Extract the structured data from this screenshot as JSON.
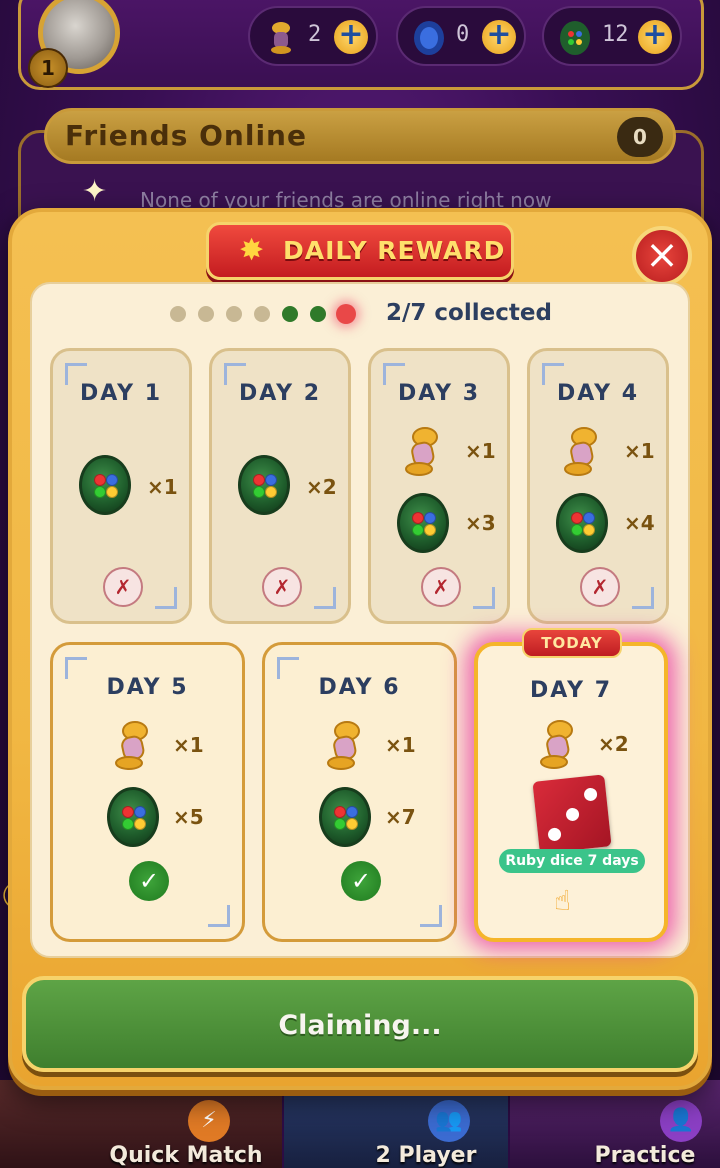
{
  "header": {
    "level": "1",
    "currencies": [
      {
        "icon": "lamp-icon",
        "value": "2"
      },
      {
        "icon": "sapphire-coin-icon",
        "value": "0"
      },
      {
        "icon": "emerald-coin-icon",
        "value": "12"
      }
    ],
    "add_label": "+"
  },
  "friends": {
    "title": "Friends Online",
    "count": "0",
    "empty_message": "None of your friends are online right now"
  },
  "modal": {
    "title": "DAILY REWARD",
    "close_label": "×",
    "progress": {
      "collected": 2,
      "total": 7,
      "text": "2/7 collected"
    },
    "days": [
      {
        "label": "DAY 1",
        "status": "missed",
        "rewards": [
          {
            "item": "coin",
            "qty": "×1"
          }
        ]
      },
      {
        "label": "DAY 2",
        "status": "missed",
        "rewards": [
          {
            "item": "coin",
            "qty": "×2"
          }
        ]
      },
      {
        "label": "DAY 3",
        "status": "missed",
        "rewards": [
          {
            "item": "lamp",
            "qty": "×1"
          },
          {
            "item": "coin",
            "qty": "×3"
          }
        ]
      },
      {
        "label": "DAY 4",
        "status": "missed",
        "rewards": [
          {
            "item": "lamp",
            "qty": "×1"
          },
          {
            "item": "coin",
            "qty": "×4"
          }
        ]
      },
      {
        "label": "DAY 5",
        "status": "collected",
        "rewards": [
          {
            "item": "lamp",
            "qty": "×1"
          },
          {
            "item": "coin",
            "qty": "×5"
          }
        ]
      },
      {
        "label": "DAY 6",
        "status": "collected",
        "rewards": [
          {
            "item": "lamp",
            "qty": "×1"
          },
          {
            "item": "coin",
            "qty": "×7"
          }
        ]
      },
      {
        "label": "DAY 7",
        "status": "today",
        "badge": "TODAY",
        "rewards": [
          {
            "item": "lamp",
            "qty": "×2"
          },
          {
            "item": "ruby-dice",
            "label": "Ruby dice 7 days"
          }
        ]
      }
    ],
    "missed_mark": "✗",
    "collected_mark": "✓",
    "claim_button": "Claiming..."
  },
  "bottom_modes": [
    {
      "label": "Quick Match",
      "icon": "lightning-icon"
    },
    {
      "label": "2 Player",
      "icon": "people-icon"
    },
    {
      "label": "Practice",
      "icon": "person-icon"
    }
  ],
  "colors": {
    "accent_gold": "#f4c052",
    "header_red": "#e8453c",
    "claim_green": "#4f9439",
    "progress_missed": "#c8b894",
    "progress_collected": "#2f7a2a",
    "progress_current": "#e94848"
  }
}
